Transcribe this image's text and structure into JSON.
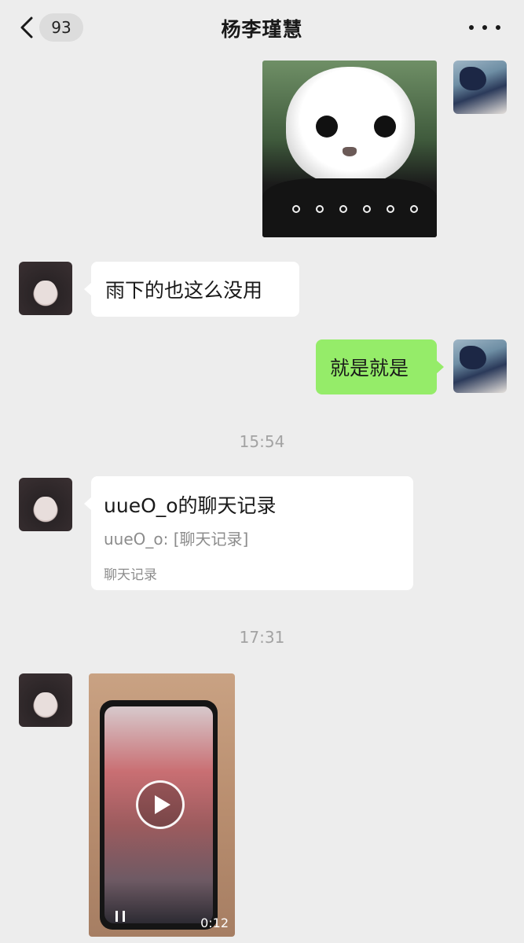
{
  "header": {
    "back_icon": "chevron-left-icon",
    "unread_count": "93",
    "title": "杨李瑾慧",
    "more_icon": "more-dots-icon"
  },
  "messages": {
    "sticker": {
      "sender": "self",
      "type": "sticker"
    },
    "text1": {
      "sender": "other",
      "text": "雨下的也这么没用"
    },
    "text2": {
      "sender": "self",
      "text": "就是就是"
    },
    "time1": "15:54",
    "card": {
      "sender": "other",
      "title": "uueO_o的聊天记录",
      "subtitle": "uueO_o: [聊天记录]",
      "footer": "聊天记录"
    },
    "time2": "17:31",
    "video": {
      "sender": "other",
      "duration": "0:12"
    }
  },
  "colors": {
    "background": "#ededed",
    "bubble_self": "#95ec69",
    "bubble_other": "#ffffff",
    "timestamp": "#a3a3a3"
  }
}
